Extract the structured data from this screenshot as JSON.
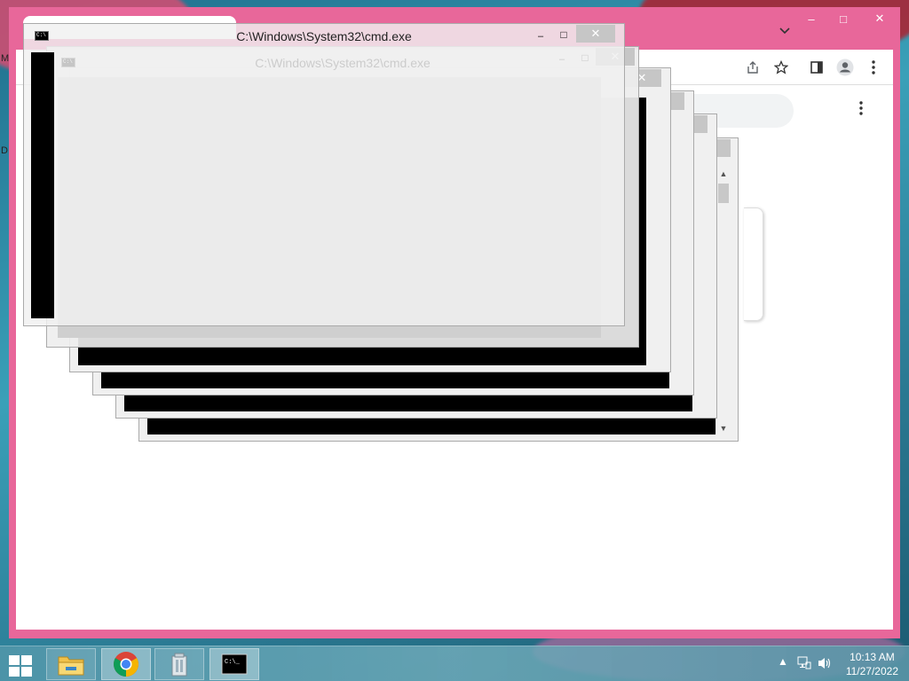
{
  "desktop": {
    "edge_letters": [
      "M",
      "D"
    ]
  },
  "chrome": {
    "controls": {
      "minimize": "–",
      "maximize": "□",
      "close": "✕"
    },
    "tab_overflow_icon": "chevron-down-icon",
    "toolbar_icons": [
      "share-icon",
      "star-icon",
      "side-panel-icon",
      "profile-icon",
      "kebab-menu-icon"
    ],
    "page_menu_icon": "kebab-menu-icon"
  },
  "cmd": {
    "title": "C:\\Windows\\System32\\cmd.exe",
    "close_glyph": "✕",
    "min_glyph": "–",
    "max_glyph": "□",
    "console_bg": "#000000"
  },
  "taskbar": {
    "start_icon": "windows-logo-icon",
    "apps": [
      {
        "name": "File Explorer",
        "icon": "folder-icon"
      },
      {
        "name": "Google Chrome",
        "icon": "chrome-icon"
      },
      {
        "name": "Recycle Bin",
        "icon": "recycle-bin-icon"
      },
      {
        "name": "Command Prompt",
        "icon": "cmd-icon"
      }
    ],
    "tray": {
      "show_hidden": "▲",
      "network_icon": "network-icon",
      "volume_icon": "volume-icon"
    },
    "time": "10:13 AM",
    "date": "11/27/2022"
  }
}
